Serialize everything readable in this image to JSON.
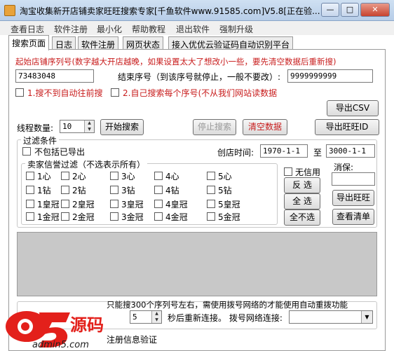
{
  "window": {
    "title": "淘宝收集新开店铺卖家旺旺搜索专家[千鱼软件www.91585.com]V5.8[正在验...",
    "min_label": "—",
    "max_label": "□",
    "close_label": "✕"
  },
  "menu": [
    "查看日志",
    "软件注册",
    "最小化",
    "帮助教程",
    "退出软件",
    "强制升级"
  ],
  "tabs": [
    "搜索页面",
    "日志",
    "软件注册",
    "网页状态",
    "接入优优云验证码自动识别平台"
  ],
  "search": {
    "start_label": "起始店铺序列号(数字越大开店越晚，如果设置太大了想改小一些，要先清空数据后重新搜)",
    "start_value": "73483048",
    "end_label": "结束序号（到该序号就停止，一般不要改）:",
    "end_value": "9999999999",
    "opt1_label": "1.搜不到自动往前搜",
    "opt2_label": "2.自己搜索每个序号(不从我们网站读数据",
    "export_csv": "导出CSV",
    "threads_label": "线程数量:",
    "threads_value": "10",
    "start_btn": "开始搜索",
    "stop_btn": "停止搜索",
    "clear_btn": "清空数据",
    "export_ww_id": "导出旺旺ID"
  },
  "filter": {
    "group_label": "过滤条件",
    "exclude_exported": "不包括已导出",
    "created_label": "创店时间:",
    "date_from": "1970-1-1",
    "date_to_label": "至",
    "date_to": "3000-1-1"
  },
  "credit": {
    "group_label": "卖家信誉过滤（不选表示所有）",
    "rows": [
      [
        "1心",
        "2心",
        "3心",
        "4心",
        "5心"
      ],
      [
        "1钻",
        "2钻",
        "3钻",
        "4钻",
        "5钻"
      ],
      [
        "1皇冠",
        "2皇冠",
        "3皇冠",
        "4皇冠",
        "5皇冠"
      ],
      [
        "1金冠",
        "2金冠",
        "3金冠",
        "4金冠",
        "5金冠"
      ]
    ],
    "use_flag": "无信用",
    "invert": "反 选",
    "select_all": "全 选",
    "select_none": "全不选"
  },
  "side": {
    "consume_label": "消保:",
    "export_ww": "导出旺旺",
    "view_list": "查看清单"
  },
  "bottom": {
    "notice": "只能搜300个序列号左右，需使用拨号网络的才能使用自动重拨功能",
    "seconds_value": "5",
    "reconnect_label": "秒后重新连接。 拨号网络连接:",
    "reg_label": "注册信息验证"
  },
  "watermark": {
    "logo_text": "a5源码",
    "site_text": "admin5.com"
  }
}
